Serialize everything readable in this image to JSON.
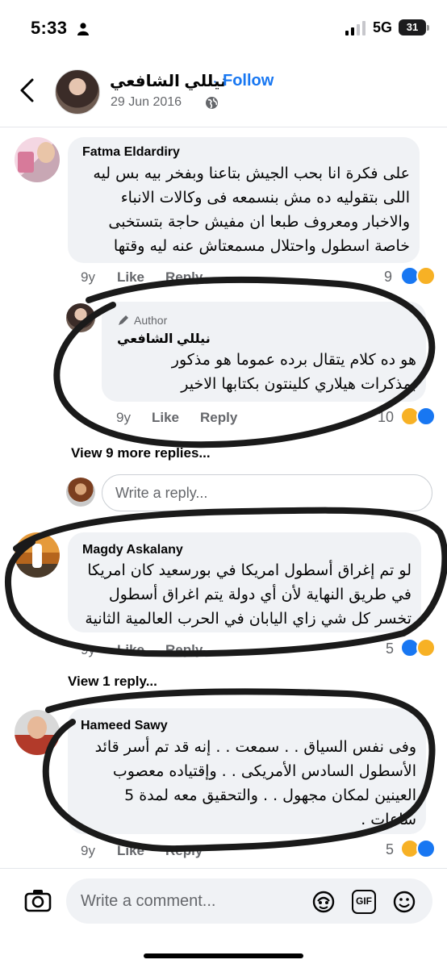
{
  "status_bar": {
    "time": "5:33",
    "network": "5G",
    "battery": "31"
  },
  "header": {
    "name": "نيللي الشافعي",
    "dot": "·",
    "follow": "Follow",
    "date": "29 Jun 2016"
  },
  "comments": [
    {
      "author": "Fatma Eldardiry",
      "lines": [
        "على فكرة انا بحب الجيش بتاعنا وبفخر بيه بس ليه",
        "اللى بتقوليه ده مش بنسمعه فى وكالات الانباء",
        "والاخبار ومعروف طبعا ان مفيش حاجة بتستخبى",
        "خاصة اسطول واحتلال مسمعتاش عنه ليه وقتها"
      ],
      "age": "9y",
      "like": "Like",
      "reply": "Reply",
      "reactions": "9"
    },
    {
      "badge": "Author",
      "author": "نيللي الشافعي",
      "lines": [
        "هو ده كلام يتقال برده عموما هو مذكور",
        "بمذكرات هيلاري كلينتون بكتابها الاخير"
      ],
      "age": "9y",
      "like": "Like",
      "reply": "Reply",
      "reactions": "10"
    },
    {
      "author": "Magdy Askalany",
      "lines": [
        "لو تم إغراق أسطول امريكا في بورسعيد كان امريكا",
        "في طريق النهاية لأن أي دولة يتم اغراق أسطول",
        "تخسر كل شي زاي اليابان في الحرب العالمية الثانية"
      ],
      "age": "9y",
      "like": "Like",
      "reply": "Reply",
      "reactions": "5"
    },
    {
      "author": "Hameed Sawy",
      "lines": [
        "وفى نفس السياق . . سمعت . . إنه قد تم أسر قائد",
        "الأسطول السادس الأمريكى . . وإقتياده معصوب",
        "العينين لمكان مجهول . . والتحقيق معه لمدة 5",
        "ساعات ."
      ],
      "age": "9y",
      "like": "Like",
      "reply": "Reply",
      "reactions": "5"
    }
  ],
  "view_more_1": "View 9 more replies...",
  "reply_placeholder": "Write a reply...",
  "view_more_2": "View 1 reply...",
  "composer_placeholder": "Write a comment...",
  "composer_icons": [
    "camera-icon",
    "avatar-sticker-icon",
    "gif-icon",
    "emoji-icon"
  ],
  "gif_label": "GIF",
  "colors": {
    "link": "#1877f2",
    "bubble": "#f0f2f5",
    "meta": "#65676b",
    "haha": "#f7b125"
  }
}
